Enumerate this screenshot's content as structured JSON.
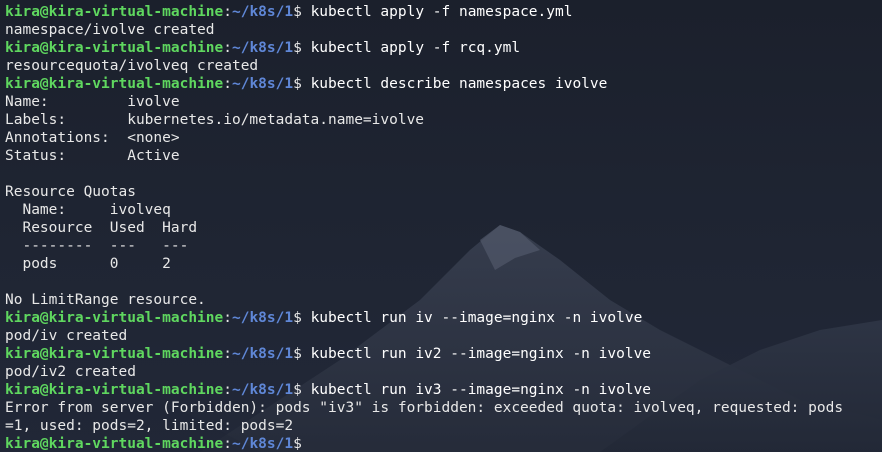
{
  "prompt": {
    "user_host": "kira@kira-virtual-machine",
    "separator": ":",
    "path": "~/k8s/1",
    "symbol": "$"
  },
  "lines": [
    {
      "type": "cmd",
      "text": "kubectl apply -f namespace.yml"
    },
    {
      "type": "out",
      "text": "namespace/ivolve created"
    },
    {
      "type": "cmd",
      "text": "kubectl apply -f rcq.yml"
    },
    {
      "type": "out",
      "text": "resourcequota/ivolveq created"
    },
    {
      "type": "cmd",
      "text": "kubectl describe namespaces ivolve"
    },
    {
      "type": "out",
      "text": "Name:         ivolve"
    },
    {
      "type": "out",
      "text": "Labels:       kubernetes.io/metadata.name=ivolve"
    },
    {
      "type": "out",
      "text": "Annotations:  <none>"
    },
    {
      "type": "out",
      "text": "Status:       Active"
    },
    {
      "type": "out",
      "text": ""
    },
    {
      "type": "out",
      "text": "Resource Quotas"
    },
    {
      "type": "out",
      "text": "  Name:     ivolveq"
    },
    {
      "type": "out",
      "text": "  Resource  Used  Hard"
    },
    {
      "type": "out",
      "text": "  --------  ---   ---"
    },
    {
      "type": "out",
      "text": "  pods      0     2"
    },
    {
      "type": "out",
      "text": ""
    },
    {
      "type": "out",
      "text": "No LimitRange resource."
    },
    {
      "type": "cmd",
      "text": "kubectl run iv --image=nginx -n ivolve"
    },
    {
      "type": "out",
      "text": "pod/iv created"
    },
    {
      "type": "cmd",
      "text": "kubectl run iv2 --image=nginx -n ivolve"
    },
    {
      "type": "out",
      "text": "pod/iv2 created"
    },
    {
      "type": "cmd",
      "text": "kubectl run iv3 --image=nginx -n ivolve"
    },
    {
      "type": "out",
      "text": "Error from server (Forbidden): pods \"iv3\" is forbidden: exceeded quota: ivolveq, requested: pods"
    },
    {
      "type": "out",
      "text": "=1, used: pods=2, limited: pods=2"
    },
    {
      "type": "cmd",
      "text": ""
    }
  ],
  "colors": {
    "user_host": "#5fd75f",
    "path": "#5f87d7",
    "text": "#e8e8e8",
    "background": "#1f2533"
  }
}
